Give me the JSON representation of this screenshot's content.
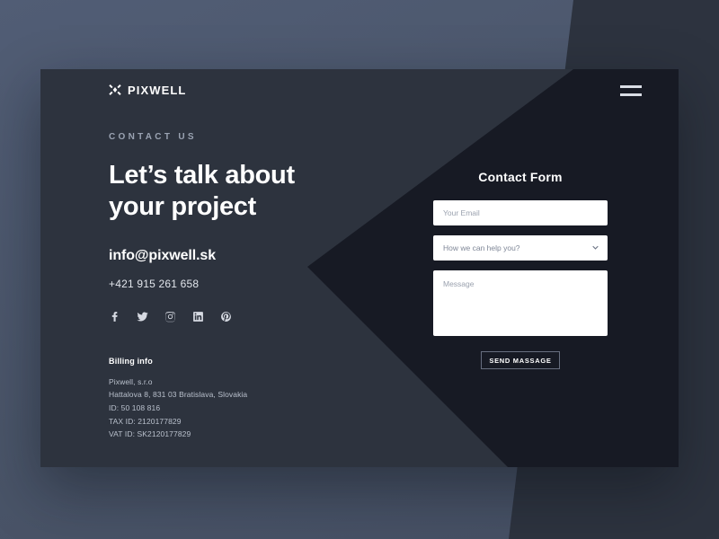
{
  "brand": {
    "name": "PIXWELL",
    "mark_icon": "x-burst-logo-icon"
  },
  "header": {
    "menu_icon": "hamburger-menu-icon"
  },
  "left": {
    "eyebrow": "CONTACT US",
    "headline": "Let’s talk about\nyour project",
    "email": "info@pixwell.sk",
    "phone": "+421 915 261 658",
    "socials": [
      {
        "name": "facebook-icon",
        "label": "Facebook"
      },
      {
        "name": "twitter-icon",
        "label": "Twitter"
      },
      {
        "name": "instagram-icon",
        "label": "Instagram"
      },
      {
        "name": "linkedin-icon",
        "label": "LinkedIn"
      },
      {
        "name": "pinterest-icon",
        "label": "Pinterest"
      }
    ],
    "billing": {
      "title": "Billing info",
      "lines": [
        "Pixwell, s.r.o",
        "Hattalova 8, 831 03 Bratislava, Slovakia",
        "ID: 50 108 816",
        "TAX ID: 2120177829",
        "VAT ID: SK2120177829"
      ]
    }
  },
  "form": {
    "title": "Contact Form",
    "email_placeholder": "Your Email",
    "email_value": "",
    "subject_selected": "How we can help you?",
    "subject_chevron_icon": "chevron-down-icon",
    "message_placeholder": "Message",
    "message_value": "",
    "submit_label": "SEND MASSAGE"
  },
  "colors": {
    "page_background": "#4c5770",
    "card_background": "#2d333e",
    "wedge_dark": "#171a24",
    "field_background": "#ffffff",
    "text_primary": "#ffffff",
    "text_muted": "#9aa3b2"
  }
}
